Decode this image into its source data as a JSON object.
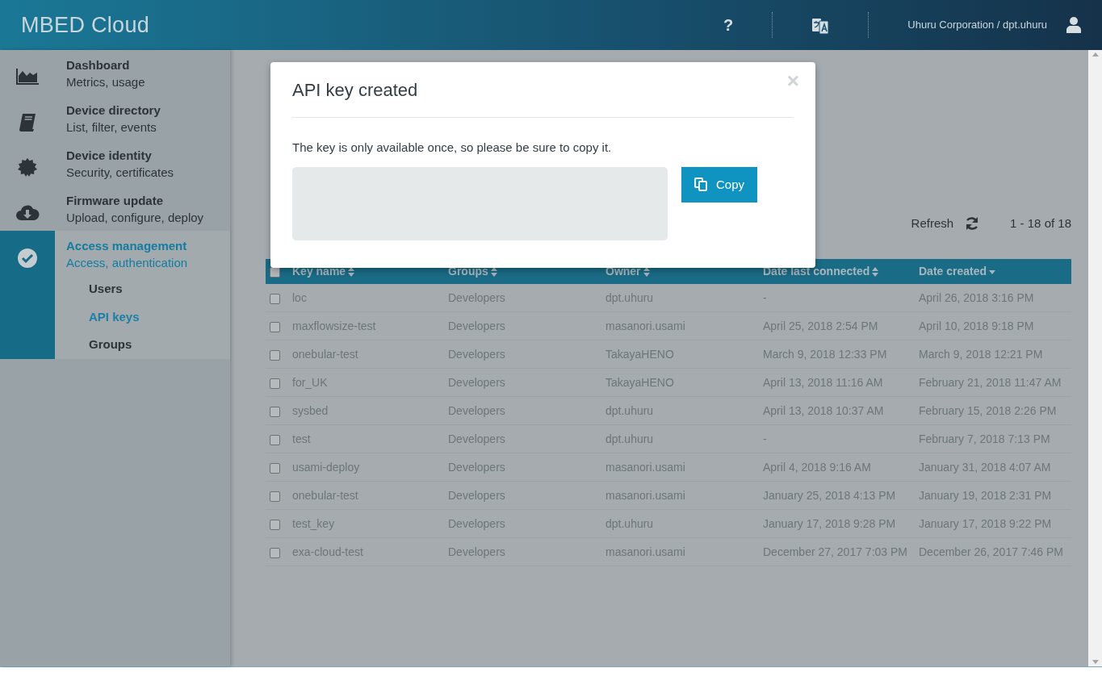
{
  "header": {
    "logo": "MBED Cloud",
    "help": "?",
    "account": "Uhuru Corporation / dpt.uhuru"
  },
  "sidebar": {
    "items": [
      {
        "kind": "chart",
        "title": "Dashboard",
        "subtitle": "Metrics, usage",
        "selected": false
      },
      {
        "kind": "book",
        "title": "Device directory",
        "subtitle": "List, filter, events",
        "selected": false
      },
      {
        "kind": "badge",
        "title": "Device identity",
        "subtitle": "Security, certificates",
        "selected": false
      },
      {
        "kind": "cloud",
        "title": "Firmware update",
        "subtitle": "Upload, configure, deploy",
        "selected": false
      },
      {
        "kind": "check",
        "title": "Access management",
        "subtitle": "Access, authentication",
        "selected": true,
        "children": [
          {
            "label": "Users",
            "selected": false
          },
          {
            "label": "API keys",
            "selected": true
          },
          {
            "label": "Groups",
            "selected": false
          }
        ]
      }
    ]
  },
  "toolbar": {
    "refresh": "Refresh",
    "pagination": "1 - 18 of 18"
  },
  "table": {
    "all_checked": false,
    "columns": [
      {
        "label": "Key name",
        "sorted": false
      },
      {
        "label": "Groups",
        "sorted": false
      },
      {
        "label": "Owner",
        "sorted": false
      },
      {
        "label": "Date last connected",
        "sorted": false
      },
      {
        "label": "Date created",
        "sorted": true
      }
    ],
    "rows": [
      {
        "checked": false,
        "cells": [
          "loc",
          "Developers",
          "dpt.uhuru",
          "-",
          "April 26, 2018 3:16 PM"
        ]
      },
      {
        "checked": false,
        "cells": [
          "maxflowsize-test",
          "Developers",
          "masanori.usami",
          "April 25, 2018 2:54 PM",
          "April 10, 2018 9:18 PM"
        ]
      },
      {
        "checked": false,
        "cells": [
          "onebular-test",
          "Developers",
          "TakayaHENO",
          "March 9, 2018 12:33 PM",
          "March 9, 2018 12:21 PM"
        ]
      },
      {
        "checked": false,
        "cells": [
          "for_UK",
          "Developers",
          "TakayaHENO",
          "April 13, 2018 11:16 AM",
          "February 21, 2018 11:47 AM"
        ]
      },
      {
        "checked": false,
        "cells": [
          "sysbed",
          "Developers",
          "dpt.uhuru",
          "April 13, 2018 10:37 AM",
          "February 15, 2018 2:26 PM"
        ]
      },
      {
        "checked": false,
        "cells": [
          "test",
          "Developers",
          "dpt.uhuru",
          "-",
          "February 7, 2018 7:13 PM"
        ]
      },
      {
        "checked": false,
        "cells": [
          "usami-deploy",
          "Developers",
          "masanori.usami",
          "April 4, 2018 9:16 AM",
          "January 31, 2018 4:07 AM"
        ]
      },
      {
        "checked": false,
        "cells": [
          "onebular-test",
          "Developers",
          "masanori.usami",
          "January 25, 2018 4:13 PM",
          "January 19, 2018 2:31 PM"
        ]
      },
      {
        "checked": false,
        "cells": [
          "test_key",
          "Developers",
          "dpt.uhuru",
          "January 17, 2018 9:28 PM",
          "January 17, 2018 9:22 PM"
        ]
      },
      {
        "checked": false,
        "cells": [
          "exa-cloud-test",
          "Developers",
          "masanori.usami",
          "December 27, 2017 7:03 PM",
          "December 26, 2017 7:46 PM"
        ]
      }
    ]
  },
  "modal": {
    "title": "API key created",
    "close": "×",
    "message": "The key is only available once, so please be sure to copy it.",
    "copy": "Copy"
  }
}
